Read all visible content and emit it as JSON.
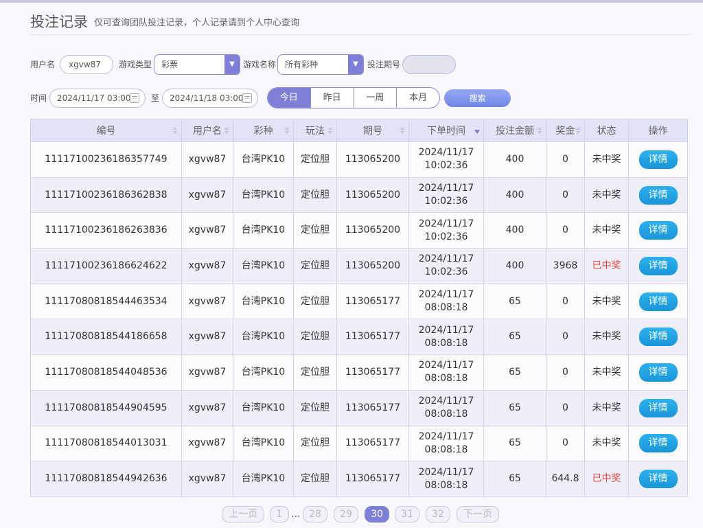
{
  "header": {
    "title": "投注记录",
    "subtitle": "仅可查询团队投注记录，个人记录请到个人中心查询"
  },
  "filters": {
    "username_label": "用户名",
    "username_value": "xgvw87",
    "game_type_label": "游戏类型",
    "game_type_value": "彩票",
    "game_name_label": "游戏名称",
    "game_name_value": "所有彩种",
    "issue_label": "投注期号",
    "issue_value": "",
    "time_label": "时间",
    "start_time": "2024/11/17 03:00",
    "to_label": "至",
    "end_time": "2024/11/18 03:00",
    "ranges": [
      "今日",
      "昨日",
      "一周",
      "本月"
    ],
    "selected_range": "今日",
    "search_label": "搜索"
  },
  "table": {
    "columns": [
      "编号",
      "用户名",
      "彩种",
      "玩法",
      "期号",
      "下单时间",
      "投注金额",
      "奖金",
      "状态",
      "操作"
    ],
    "rows": [
      {
        "id": "11117100236186357749",
        "user": "xgvw87",
        "lottery": "台湾PK10",
        "play": "定位胆",
        "issue": "113065200",
        "date": "2024/11/17",
        "time": "10:02:36",
        "amount": "400",
        "prize": "0",
        "status": "未中奖",
        "action": "详情"
      },
      {
        "id": "11117100236186362838",
        "user": "xgvw87",
        "lottery": "台湾PK10",
        "play": "定位胆",
        "issue": "113065200",
        "date": "2024/11/17",
        "time": "10:02:36",
        "amount": "400",
        "prize": "0",
        "status": "未中奖",
        "action": "详情"
      },
      {
        "id": "11117100236186263836",
        "user": "xgvw87",
        "lottery": "台湾PK10",
        "play": "定位胆",
        "issue": "113065200",
        "date": "2024/11/17",
        "time": "10:02:36",
        "amount": "400",
        "prize": "0",
        "status": "未中奖",
        "action": "详情"
      },
      {
        "id": "11117100236186624622",
        "user": "xgvw87",
        "lottery": "台湾PK10",
        "play": "定位胆",
        "issue": "113065200",
        "date": "2024/11/17",
        "time": "10:02:36",
        "amount": "400",
        "prize": "3968",
        "status": "已中奖",
        "action": "详情"
      },
      {
        "id": "11117080818544463534",
        "user": "xgvw87",
        "lottery": "台湾PK10",
        "play": "定位胆",
        "issue": "113065177",
        "date": "2024/11/17",
        "time": "08:08:18",
        "amount": "65",
        "prize": "0",
        "status": "未中奖",
        "action": "详情"
      },
      {
        "id": "11117080818544186658",
        "user": "xgvw87",
        "lottery": "台湾PK10",
        "play": "定位胆",
        "issue": "113065177",
        "date": "2024/11/17",
        "time": "08:08:18",
        "amount": "65",
        "prize": "0",
        "status": "未中奖",
        "action": "详情"
      },
      {
        "id": "11117080818544048536",
        "user": "xgvw87",
        "lottery": "台湾PK10",
        "play": "定位胆",
        "issue": "113065177",
        "date": "2024/11/17",
        "time": "08:08:18",
        "amount": "65",
        "prize": "0",
        "status": "未中奖",
        "action": "详情"
      },
      {
        "id": "11117080818544904595",
        "user": "xgvw87",
        "lottery": "台湾PK10",
        "play": "定位胆",
        "issue": "113065177",
        "date": "2024/11/17",
        "time": "08:08:18",
        "amount": "65",
        "prize": "0",
        "status": "未中奖",
        "action": "详情"
      },
      {
        "id": "11117080818544013031",
        "user": "xgvw87",
        "lottery": "台湾PK10",
        "play": "定位胆",
        "issue": "113065177",
        "date": "2024/11/17",
        "time": "08:08:18",
        "amount": "65",
        "prize": "0",
        "status": "未中奖",
        "action": "详情"
      },
      {
        "id": "11117080818544942636",
        "user": "xgvw87",
        "lottery": "台湾PK10",
        "play": "定位胆",
        "issue": "113065177",
        "date": "2024/11/17",
        "time": "08:08:18",
        "amount": "65",
        "prize": "644.8",
        "status": "已中奖",
        "action": "详情"
      }
    ]
  },
  "pagination": {
    "prev": "上一页",
    "first": "1",
    "ellipsis": "...",
    "pages": [
      "28",
      "29",
      "30",
      "31",
      "32"
    ],
    "current": "30",
    "next": "下一页"
  },
  "colors": {
    "accent": "#7d80d6",
    "detail_button": "#1996d8",
    "won_status": "#e8433f"
  }
}
